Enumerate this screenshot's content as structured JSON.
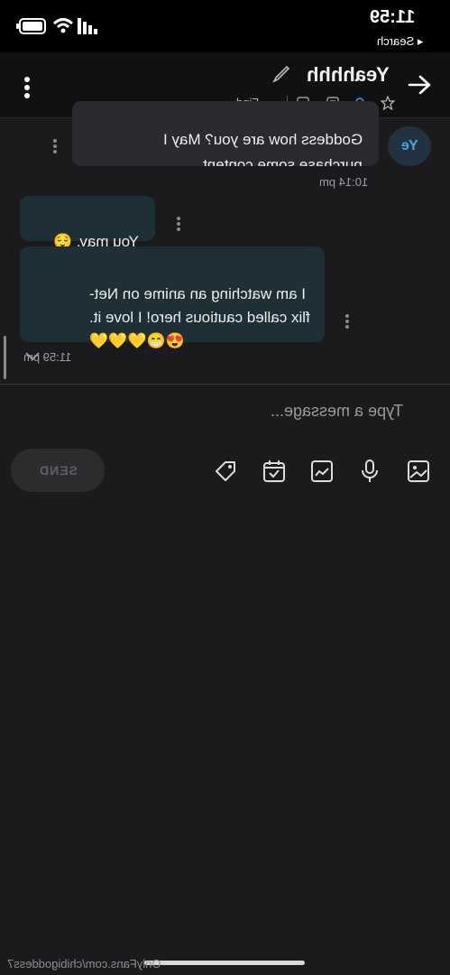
{
  "status_bar": {
    "time": "11:59",
    "back_app": "◂ Search"
  },
  "header": {
    "title": "Yeahhhh",
    "find_label": "Find"
  },
  "messages": [
    {
      "from": "other",
      "avatar_initials": "Ye",
      "text_partial_top": "Goddess how are you? May I",
      "text": "purchase some content",
      "time": "10:14 pm"
    },
    {
      "from": "me",
      "text": "You may. 😌"
    },
    {
      "from": "me",
      "text": "I am watching an anime on Net-\nflix called cautious hero! I love it.\n😍😁💛💛💛",
      "time": "11:59 pm"
    }
  ],
  "composer": {
    "placeholder": "Type a message...",
    "send_label": "SEND"
  },
  "watermark": "OnlyFans.com/chibigoddess7",
  "colors": {
    "background": "#1b1b1d",
    "my_bubble": "#1f2f36",
    "their_bubble": "#2a2b2e",
    "accent": "#4aa3df"
  }
}
